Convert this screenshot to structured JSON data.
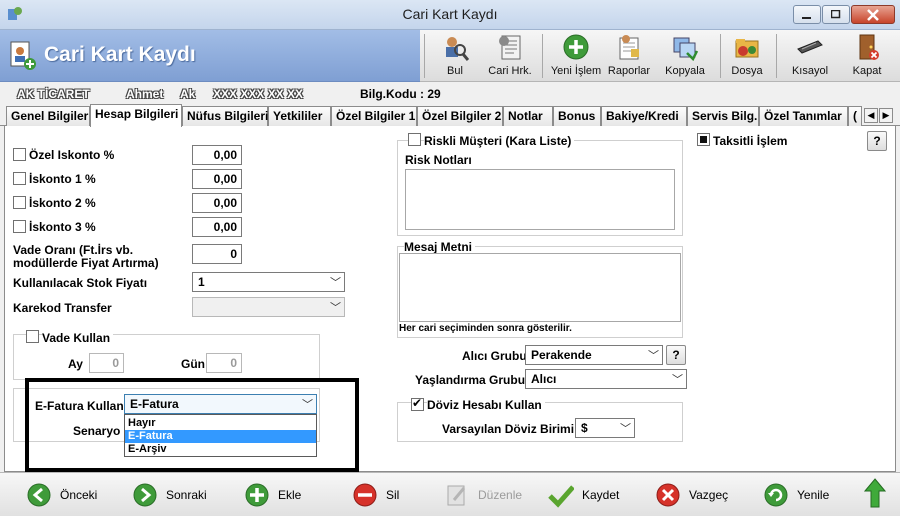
{
  "window": {
    "title": "Cari Kart Kaydı"
  },
  "header": {
    "title": "Cari Kart Kaydı"
  },
  "toolbar": {
    "bul": "Bul",
    "cari_hrk": "Cari Hrk.",
    "yeni_islem": "Yeni İşlem",
    "raporlar": "Raporlar",
    "kopyala": "Kopyala",
    "dosya": "Dosya",
    "kisayol": "Kısayol",
    "kapat": "Kapat"
  },
  "info": {
    "company": "AK TİCARET",
    "first_name": "Ahmet",
    "last_name": "Ak",
    "phone": "XXX XXX XX XX",
    "bilg_kodu": "Bilg.Kodu : 29"
  },
  "tabs": [
    "Genel Bilgiler",
    "Hesap Bilgileri",
    "Nüfus Bilgileri",
    "Yetkililer",
    "Özel Bilgiler 1",
    "Özel Bilgiler 2",
    "Notlar",
    "Bonus",
    "Bakiye/Kredi",
    "Servis Bilg.",
    "Özel Tanımlar",
    "("
  ],
  "form": {
    "ozel_iskonto_label": "Özel Iskonto %",
    "ozel_iskonto_value": "0,00",
    "iskonto1_label": "İskonto 1 %",
    "iskonto1_value": "0,00",
    "iskonto2_label": "İskonto 2 %",
    "iskonto2_value": "0,00",
    "iskonto3_label": "İskonto 3 %",
    "iskonto3_value": "0,00",
    "vade_orani_label_1": "Vade Oranı (Ft.İrs vb.",
    "vade_orani_label_2": "modüllerde Fiyat Artırma)",
    "vade_orani_value": "0",
    "stok_fiyati_label": "Kullanılacak Stok Fiyatı",
    "stok_fiyati_value": "1",
    "karekod_label": "Karekod Transfer",
    "karekod_value": "",
    "vade_kullan_label": "Vade Kullan",
    "ay_label": "Ay",
    "ay_value": "0",
    "gun_label": "Gün",
    "gun_value": "0",
    "efatura_label": "E-Fatura Kullan",
    "efatura_value": "E-Fatura",
    "senaryo_label": "Senaryo",
    "efatura_options": [
      "Hayır",
      "E-Fatura",
      "E-Arşiv"
    ],
    "riskli_label": "Riskli Müşteri (Kara Liste)",
    "risk_notlari_label": "Risk Notları",
    "mesaj_metni_label": "Mesaj Metni",
    "mesaj_note": "Her cari seçiminden sonra gösterilir.",
    "alici_grubu_label": "Alıcı Grubu",
    "alici_grubu_value": "Perakende",
    "yaslandirma_label": "Yaşlandırma Grubu",
    "yaslandirma_value": "Alıcı",
    "doviz_label": "Döviz Hesabı Kullan",
    "varsayilan_doviz_label": "Varsayılan Döviz Birimi",
    "varsayilan_doviz_value": "$",
    "taksitli_label": "Taksitli İşlem",
    "help": "?"
  },
  "bottom": {
    "onceki": "Önceki",
    "sonraki": "Sonraki",
    "ekle": "Ekle",
    "sil": "Sil",
    "duzenle": "Düzenle",
    "kaydet": "Kaydet",
    "vazgec": "Vazgeç",
    "yenile": "Yenile"
  }
}
